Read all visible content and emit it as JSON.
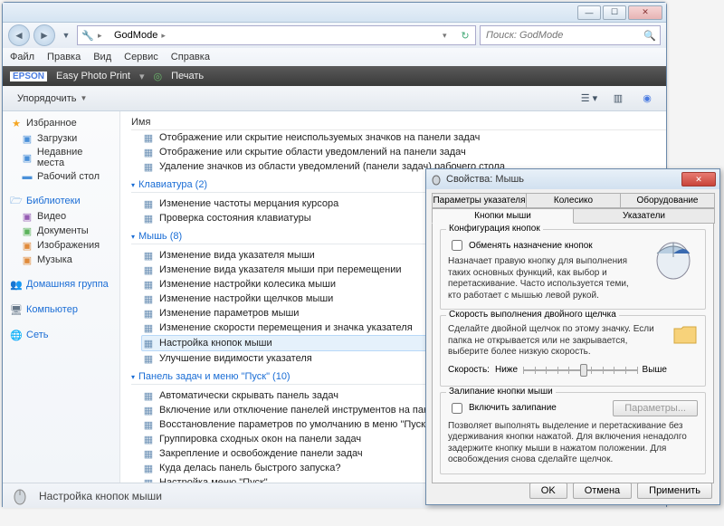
{
  "window": {
    "breadcrumb_text": "GodMode",
    "search_placeholder": "Поиск: GodMode"
  },
  "menu": {
    "file": "Файл",
    "edit": "Правка",
    "view": "Вид",
    "service": "Сервис",
    "help": "Справка"
  },
  "epson": {
    "logo": "EPSON",
    "app": "Easy Photo Print",
    "print": "Печать"
  },
  "cmd": {
    "organize": "Упорядочить"
  },
  "sidebar": {
    "favorites": {
      "title": "Избранное",
      "items": [
        "Загрузки",
        "Недавние места",
        "Рабочий стол"
      ]
    },
    "libraries": {
      "title": "Библиотеки",
      "items": [
        "Видео",
        "Документы",
        "Изображения",
        "Музыка"
      ]
    },
    "homegroup": "Домашняя группа",
    "computer": "Компьютер",
    "network": "Сеть"
  },
  "column_header": "Имя",
  "groups": [
    {
      "title": "",
      "items": [
        "Отображение или скрытие неиспользуемых значков на панели задач",
        "Отображение или скрытие области уведомлений на панели задач",
        "Удаление значков из области уведомлений (панели задач) рабочего стола"
      ]
    },
    {
      "title": "Клавиатура (2)",
      "items": [
        "Изменение частоты мерцания курсора",
        "Проверка состояния клавиатуры"
      ]
    },
    {
      "title": "Мышь (8)",
      "items": [
        "Изменение вида указателя мыши",
        "Изменение вида указателя мыши при перемещении",
        "Изменение настройки колесика мыши",
        "Изменение настройки щелчков мыши",
        "Изменение параметров мыши",
        "Изменение скорости перемещения и значка указателя",
        "Настройка кнопок мыши",
        "Улучшение видимости указателя"
      ],
      "selected": 6
    },
    {
      "title": "Панель задач и меню \"Пуск\" (10)",
      "items": [
        "Автоматически скрывать панель задач",
        "Включение или отключение панелей инструментов на панели задач",
        "Восстановление параметров по умолчанию в меню \"Пуск\"",
        "Группировка сходных окон на панели задач",
        "Закрепление и освобождение панели задач",
        "Куда делась панель быстрого запуска?",
        "Настройка меню \"Пуск\""
      ]
    }
  ],
  "status": "Настройка кнопок мыши",
  "dialog": {
    "title": "Свойства: Мышь",
    "tabs": {
      "r1": [
        "Параметры указателя",
        "Колесико",
        "Оборудование"
      ],
      "r2": [
        "Кнопки мыши",
        "Указатели"
      ]
    },
    "g1": {
      "title": "Конфигурация кнопок",
      "chk": "Обменять назначение кнопок",
      "desc": "Назначает правую кнопку для выполнения таких основных функций, как выбор и перетаскивание. Часто используется теми, кто работает с мышью левой рукой."
    },
    "g2": {
      "title": "Скорость выполнения двойного щелчка",
      "desc": "Сделайте двойной щелчок по этому значку. Если папка не открывается или не закрывается, выберите более низкую скорость.",
      "speed": "Скорость:",
      "low": "Ниже",
      "high": "Выше"
    },
    "g3": {
      "title": "Залипание кнопки мыши",
      "chk": "Включить залипание",
      "btn": "Параметры...",
      "desc": "Позволяет выполнять выделение и перетаскивание без удерживания кнопки нажатой. Для включения ненадолго задержите кнопку мыши в нажатом положении. Для освобождения снова сделайте щелчок."
    },
    "btns": {
      "ok": "OK",
      "cancel": "Отмена",
      "apply": "Применить"
    }
  }
}
